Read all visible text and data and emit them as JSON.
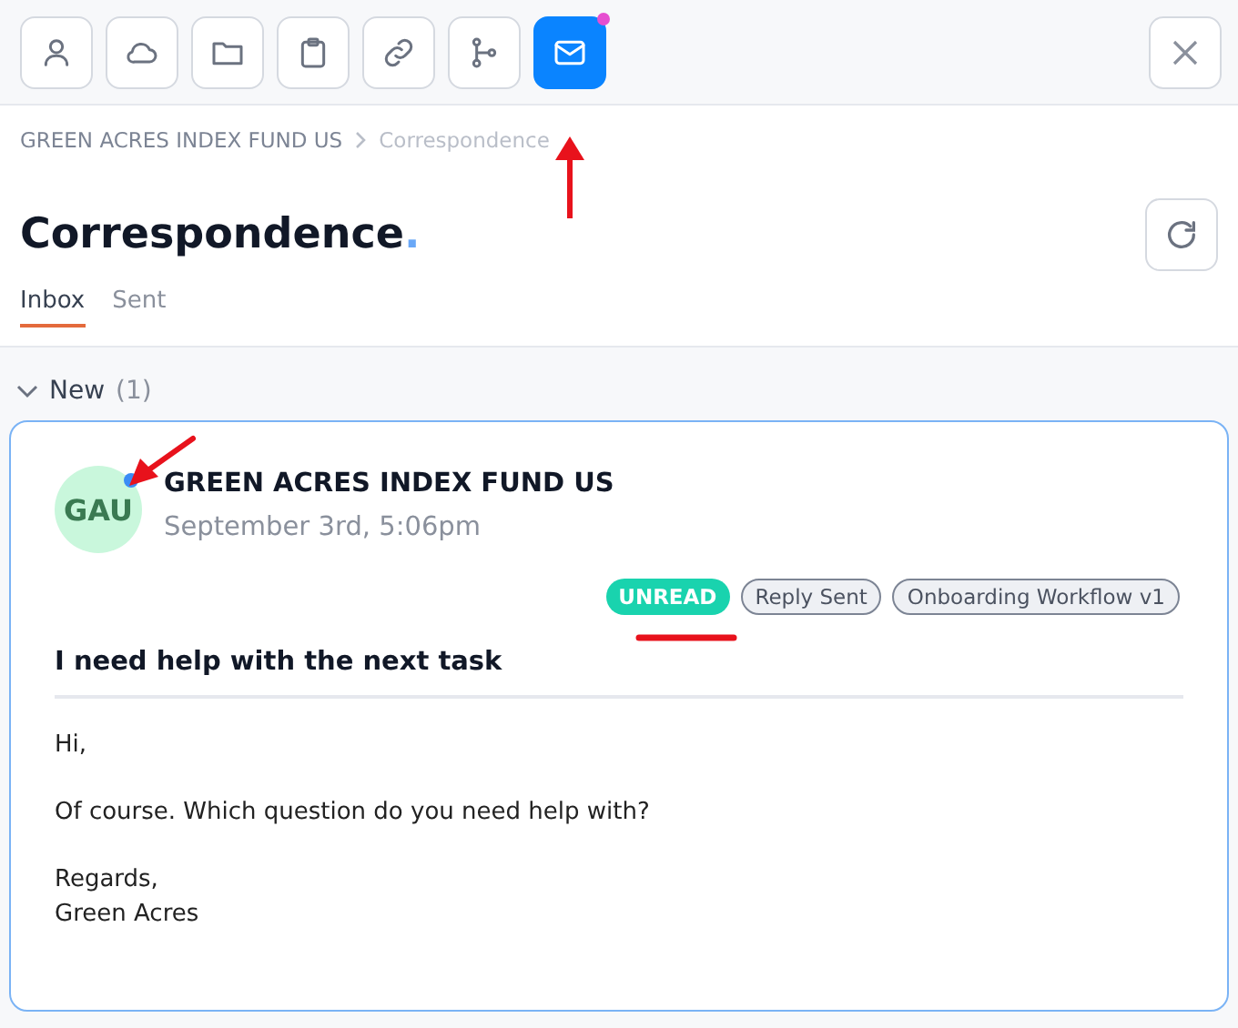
{
  "toolbar": {
    "buttons": [
      {
        "kind": "person",
        "selected": false,
        "notification": false
      },
      {
        "kind": "cloud",
        "selected": false,
        "notification": false
      },
      {
        "kind": "folder",
        "selected": false,
        "notification": false
      },
      {
        "kind": "clipboard",
        "selected": false,
        "notification": false
      },
      {
        "kind": "link",
        "selected": false,
        "notification": false
      },
      {
        "kind": "branch",
        "selected": false,
        "notification": false
      },
      {
        "kind": "mail",
        "selected": true,
        "notification": true
      }
    ]
  },
  "breadcrumb": [
    "GREEN ACRES INDEX FUND US",
    "Correspondence"
  ],
  "page_title": "Correspondence",
  "page_title_dot": ".",
  "tabs": [
    {
      "label": "Inbox",
      "selected": true
    },
    {
      "label": "Sent",
      "selected": false
    }
  ],
  "section": {
    "title": "New",
    "count": "(1)",
    "expanded": true
  },
  "message": {
    "initials": "GAU",
    "unread": true,
    "sender": "GREEN ACRES INDEX FUND US",
    "date": "September 3rd, 5:06pm",
    "badges": [
      {
        "label": "UNREAD",
        "kind": "status"
      },
      {
        "label": "Reply Sent",
        "kind": "tag"
      },
      {
        "label": "Onboarding Workflow v1",
        "kind": "tag"
      }
    ],
    "subject": "I need help with the next task",
    "body": [
      [
        "Hi,"
      ],
      [
        "Of course. Which question do you need help with?"
      ],
      [
        "Regards,",
        "Green Acres"
      ]
    ]
  }
}
